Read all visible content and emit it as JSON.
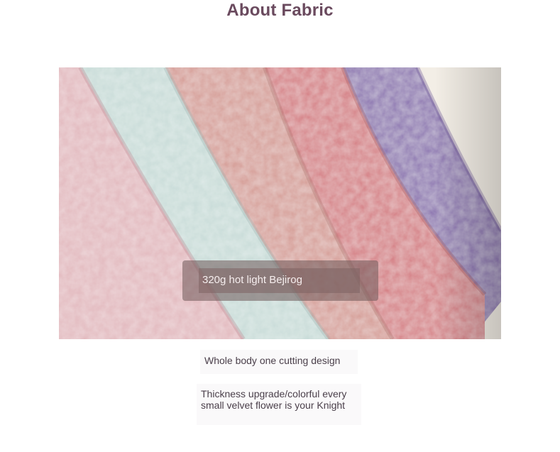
{
  "page": {
    "title": "About Fabric"
  },
  "photo": {
    "overlay_text": "320g hot light Bejirog",
    "colors": {
      "pink": "#e3b9bf",
      "mint": "#c9dcd8",
      "rose": "#d99e98",
      "coral": "#d47f83",
      "lavender": "#8f78b3",
      "cream": "#f4efe6"
    }
  },
  "captions": {
    "first": "Whole body one cutting design",
    "second_line1": "Thickness upgrade/colorful every",
    "second_line2": "small velvet flower is your Knight"
  }
}
